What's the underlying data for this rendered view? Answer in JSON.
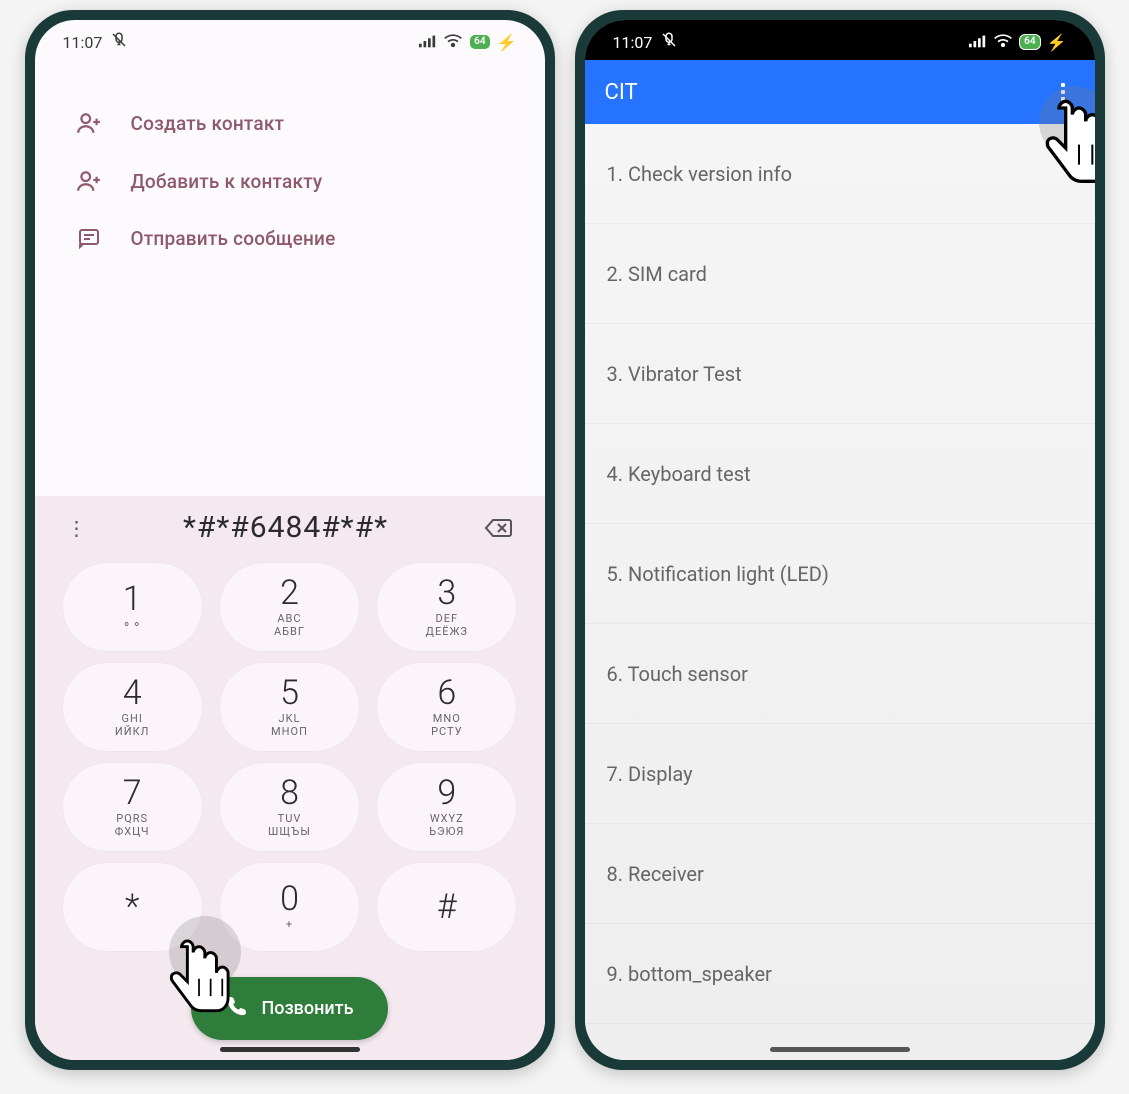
{
  "status": {
    "time": "11:07",
    "battery_label": "64"
  },
  "dialer": {
    "actions": {
      "create_contact": "Создать контакт",
      "add_to_contact": "Добавить к контакту",
      "send_message": "Отправить сообщение"
    },
    "entry": "*#*#6484#*#*",
    "keys": [
      {
        "digit": "1",
        "l1": "",
        "l2": "⚬⚬"
      },
      {
        "digit": "2",
        "l1": "ABC",
        "l2": "АБВГ"
      },
      {
        "digit": "3",
        "l1": "DEF",
        "l2": "ДЕЁЖЗ"
      },
      {
        "digit": "4",
        "l1": "GHI",
        "l2": "ИЙКЛ"
      },
      {
        "digit": "5",
        "l1": "JKL",
        "l2": "МНОП"
      },
      {
        "digit": "6",
        "l1": "MNO",
        "l2": "РСТУ"
      },
      {
        "digit": "7",
        "l1": "PQRS",
        "l2": "ФХЦЧ"
      },
      {
        "digit": "8",
        "l1": "TUV",
        "l2": "ШЩЪЫ"
      },
      {
        "digit": "9",
        "l1": "WXYZ",
        "l2": "ЬЭЮЯ"
      },
      {
        "digit": "*",
        "l1": "",
        "l2": ""
      },
      {
        "digit": "0",
        "l1": "",
        "l2": "+"
      },
      {
        "digit": "#",
        "l1": "",
        "l2": ""
      }
    ],
    "call_label": "Позвонить"
  },
  "cit": {
    "title": "CIT",
    "items": [
      "1. Check version info",
      "2. SIM card",
      "3. Vibrator Test",
      "4. Keyboard test",
      "5. Notification light (LED)",
      "6. Touch sensor",
      "7. Display",
      "8. Receiver",
      "9. bottom_speaker"
    ]
  }
}
